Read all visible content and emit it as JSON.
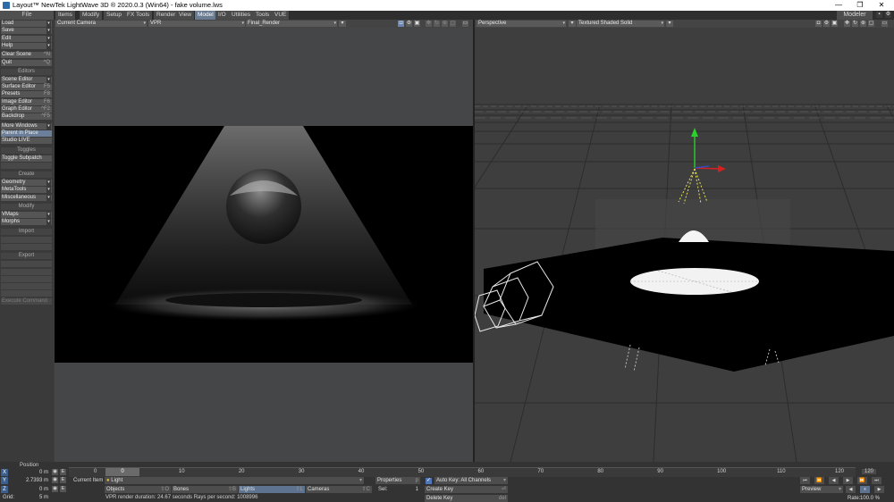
{
  "window": {
    "title": "Layout™ NewTek LightWave 3D ® 2020.0.3 (Win64) - fake volume.lws",
    "minimize": "—",
    "restore": "❐",
    "close": "✕"
  },
  "menu": {
    "file_header": "File",
    "tabs": [
      "Items",
      "Modify",
      "Setup",
      "FX Tools",
      "Render",
      "View",
      "Model",
      "I/O",
      "Utilities",
      "Tools",
      "VUE"
    ],
    "active_tab": "Model",
    "modeler": "Modeler"
  },
  "sidebar": {
    "file_items": [
      {
        "label": "Load",
        "arrow": true
      },
      {
        "label": "Save",
        "arrow": true
      },
      {
        "label": "Edit",
        "arrow": true
      },
      {
        "label": "Help",
        "arrow": true
      },
      {
        "label": "Clear Scene",
        "key": "^N"
      },
      {
        "label": "Quit",
        "key": "^Q"
      }
    ],
    "editors_header": "Editors",
    "editor_items": [
      {
        "label": "Scene Editor",
        "arrow": true
      },
      {
        "label": "Surface Editor",
        "key": "F5"
      },
      {
        "label": "Presets",
        "key": "F8"
      },
      {
        "label": "Image Editor",
        "key": "F6"
      },
      {
        "label": "Graph Editor",
        "key": "^F2"
      },
      {
        "label": "Backdrop",
        "key": "^F5"
      },
      {
        "label": "More Windows",
        "arrow": true
      },
      {
        "label": "Parent in Place",
        "selected": true
      },
      {
        "label": "Studio LIVE"
      }
    ],
    "toggles_header": "Toggles",
    "toggle_items": [
      {
        "label": "Toggle Subpatch"
      }
    ],
    "create_header": "Create",
    "create_items": [
      {
        "label": "Geometry",
        "arrow": true
      },
      {
        "label": "MetaTools",
        "arrow": true
      },
      {
        "label": "Miscellaneous",
        "arrow": true
      }
    ],
    "modify_header": "Modify",
    "modify_items": [
      {
        "label": "VMaps",
        "arrow": true
      },
      {
        "label": "Morphs",
        "arrow": true
      }
    ],
    "import_header": "Import",
    "export_header": "Export",
    "export_items": [
      {
        "label": "Execute Command"
      }
    ]
  },
  "viewport_left": {
    "camera": "Current Camera",
    "mode": "VPR",
    "preset": "Final_Render"
  },
  "viewport_right": {
    "view": "Perspective",
    "shading": "Textured Shaded Solid"
  },
  "timeline": {
    "position_label": "Position",
    "x": {
      "axis": "X",
      "value": "0 m"
    },
    "y": {
      "axis": "Y",
      "value": "2.7393 m"
    },
    "z": {
      "axis": "Z",
      "value": "0 m"
    },
    "grid_label": "Grid:",
    "grid_value": "5 m",
    "frame_start": "0",
    "frame_current": "0",
    "frame_end": "120",
    "ticks": [
      10,
      20,
      30,
      40,
      50,
      60,
      70,
      80,
      90,
      100,
      110,
      120
    ],
    "current_item_label": "Current Item",
    "current_item": "Light",
    "properties": "Properties",
    "sel_label": "Sel:",
    "sel_value": "1",
    "auto_key": "Auto Key: All Channels",
    "create_key": "Create Key",
    "delete_key": "Delete Key",
    "objects": "Objects",
    "bones": "Bones",
    "lights": "Lights",
    "cameras": "Cameras",
    "status": "VPR render duration: 24.67 seconds  Rays per second: 1008996",
    "preview": "Preview",
    "rate_label": "Rate:",
    "rate_value": "100.0 %"
  }
}
